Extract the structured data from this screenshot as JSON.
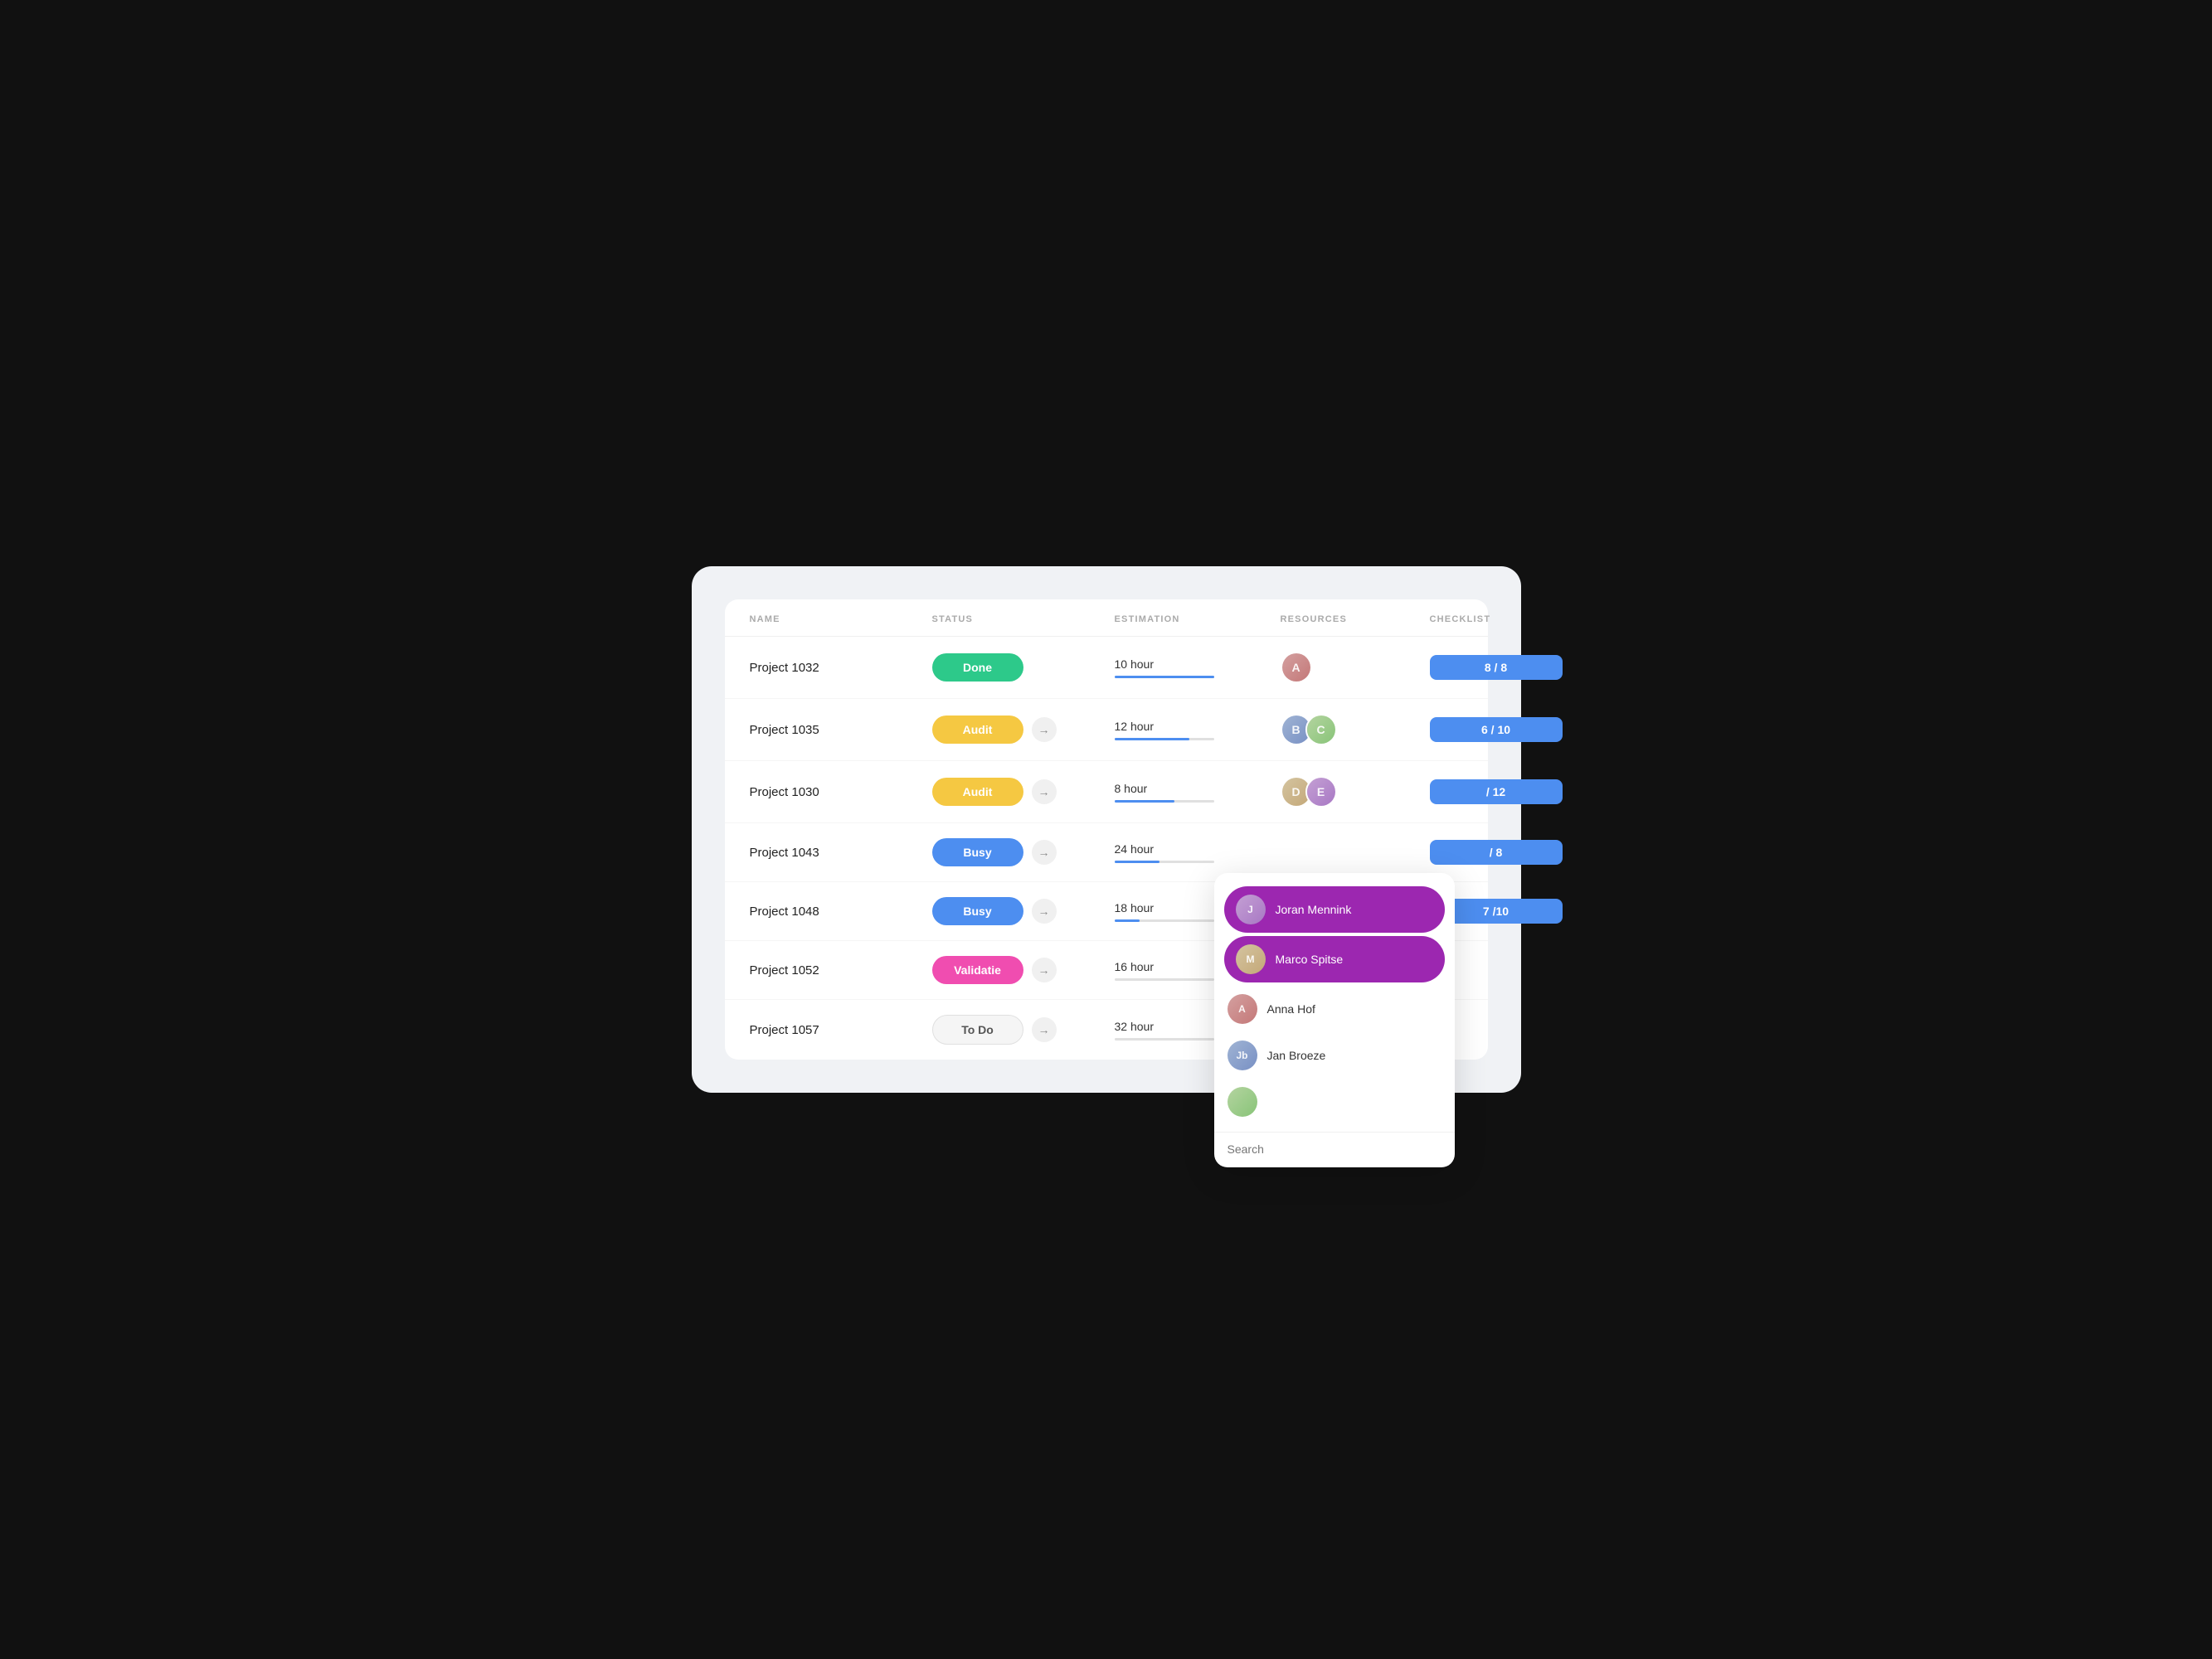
{
  "table": {
    "headers": {
      "name": "NAME",
      "status": "STATUS",
      "estimation": "ESTIMATION",
      "resources": "RESOURCES",
      "checklist": "CHECKLIST"
    },
    "rows": [
      {
        "id": "row-1032",
        "name": "Project 1032",
        "status": {
          "label": "Done",
          "type": "done"
        },
        "estimation": {
          "label": "10 hour",
          "progress": 100
        },
        "resources": [
          {
            "initials": "A",
            "class": "face-1"
          }
        ],
        "checklist": "8 / 8",
        "hasArrow": false
      },
      {
        "id": "row-1035",
        "name": "Project 1035",
        "status": {
          "label": "Audit",
          "type": "audit"
        },
        "estimation": {
          "label": "12 hour",
          "progress": 75
        },
        "resources": [
          {
            "initials": "B",
            "class": "face-2"
          },
          {
            "initials": "C",
            "class": "face-3"
          }
        ],
        "checklist": "6 / 10",
        "hasArrow": true
      },
      {
        "id": "row-1030",
        "name": "Project 1030",
        "status": {
          "label": "Audit",
          "type": "audit"
        },
        "estimation": {
          "label": "8 hour",
          "progress": 60
        },
        "resources": [
          {
            "initials": "D",
            "class": "face-4"
          },
          {
            "initials": "E",
            "class": "face-5"
          }
        ],
        "checklist": "/ 12",
        "hasArrow": true
      },
      {
        "id": "row-1043",
        "name": "Project 1043",
        "status": {
          "label": "Busy",
          "type": "busy"
        },
        "estimation": {
          "label": "24 hour",
          "progress": 45
        },
        "resources": [],
        "checklist": "/ 8",
        "hasArrow": true
      },
      {
        "id": "row-1048",
        "name": "Project 1048",
        "status": {
          "label": "Busy",
          "type": "busy"
        },
        "estimation": {
          "label": "18 hour",
          "progress": 25
        },
        "resources": [],
        "checklist": "7 /10",
        "hasArrow": true
      },
      {
        "id": "row-1052",
        "name": "Project 1052",
        "status": {
          "label": "Validatie",
          "type": "validatie"
        },
        "estimation": {
          "label": "16 hour",
          "progress": 0
        },
        "resources": [],
        "checklist": "",
        "hasArrow": true
      },
      {
        "id": "row-1057",
        "name": "Project 1057",
        "status": {
          "label": "To Do",
          "type": "todo"
        },
        "estimation": {
          "label": "32 hour",
          "progress": 0
        },
        "resources": [],
        "checklist": "",
        "hasArrow": true
      }
    ]
  },
  "dropdown": {
    "items": [
      {
        "name": "Joran Mennink",
        "initials": "J",
        "selected": true,
        "class": "face-5"
      },
      {
        "name": "Marco Spitse",
        "initials": "M",
        "selected": true,
        "class": "face-4"
      },
      {
        "name": "Anna Hof",
        "initials": "A",
        "selected": false,
        "class": "face-1"
      },
      {
        "name": "Jan Broeze",
        "initials": "Jb",
        "selected": false,
        "class": "face-2"
      },
      {
        "name": "?",
        "initials": "?",
        "selected": false,
        "class": "face-3"
      }
    ],
    "search_placeholder": "Search"
  }
}
